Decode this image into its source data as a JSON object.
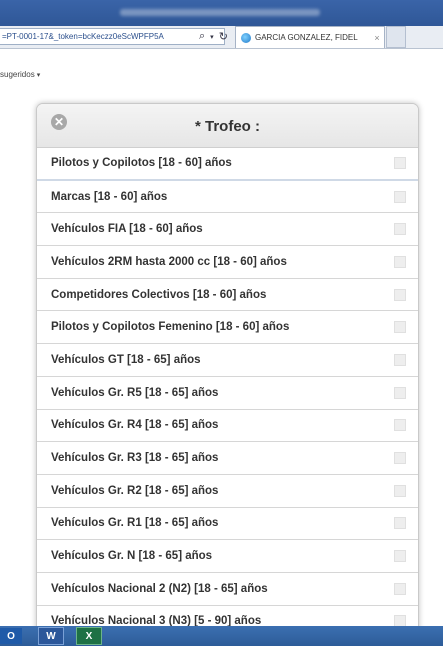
{
  "browser": {
    "url": "=PT-0001-17&_token=bcKeczz0eScWPFP5A",
    "tab_title": "GARCIA GONZALEZ, FIDEL",
    "tab_close": "×",
    "favorites_label": "sugeridos",
    "favorites_caret": "▾"
  },
  "modal": {
    "title": "* Trofeo :",
    "close_symbol": "✕",
    "options": [
      {
        "label": "Pilotos y Copilotos [18 - 60] años",
        "checked": false
      },
      {
        "label": "Marcas [18 - 60] años",
        "checked": false
      },
      {
        "label": "Vehículos FIA [18 - 60] años",
        "checked": false
      },
      {
        "label": "Vehículos 2RM hasta 2000 cc [18 - 60] años",
        "checked": false
      },
      {
        "label": "Competidores Colectivos [18 - 60] años",
        "checked": false
      },
      {
        "label": "Pilotos y Copilotos Femenino [18 - 60] años",
        "checked": false
      },
      {
        "label": "Vehículos GT [18 - 65] años",
        "checked": false
      },
      {
        "label": "Vehículos Gr. R5 [18 - 65] años",
        "checked": false
      },
      {
        "label": "Vehículos Gr. R4 [18 - 65] años",
        "checked": false
      },
      {
        "label": "Vehículos Gr. R3 [18 - 65] años",
        "checked": false
      },
      {
        "label": "Vehículos Gr. R2 [18 - 65] años",
        "checked": false
      },
      {
        "label": "Vehículos Gr. R1 [18 - 65] años",
        "checked": false
      },
      {
        "label": "Vehículos Gr. N [18 - 65] años",
        "checked": false
      },
      {
        "label": "Vehículos Nacional 2 (N2) [18 - 65] años",
        "checked": false
      },
      {
        "label": "Vehículos Nacional 3 (N3) [5 - 90] años",
        "checked": false
      }
    ]
  },
  "taskbar": {
    "outlook_label": "O",
    "word_label": "W",
    "excel_label": "X"
  },
  "colors": {
    "title_bar": "#2f5797",
    "taskbar": "#2d5c98",
    "panel_header": "#eeeeee"
  }
}
